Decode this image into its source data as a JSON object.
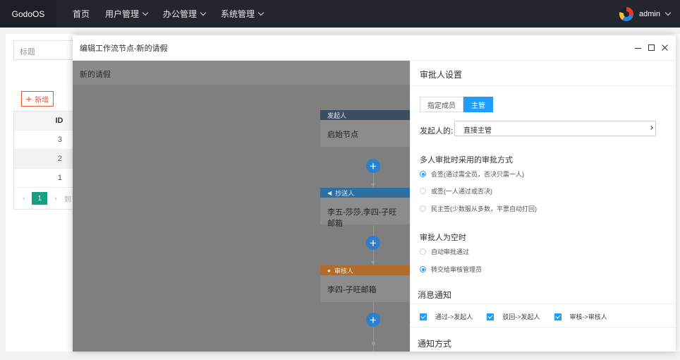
{
  "app": {
    "name": "GodoOS"
  },
  "nav": {
    "items": [
      {
        "label": "首页",
        "dropdown": false
      },
      {
        "label": "用户管理",
        "dropdown": true
      },
      {
        "label": "办公管理",
        "dropdown": true
      },
      {
        "label": "系统管理",
        "dropdown": true
      }
    ]
  },
  "user": {
    "name": "admin",
    "avatar_icon": "avatar-icon"
  },
  "background": {
    "search_placeholder": "标题",
    "add_label": "新增",
    "table": {
      "header": "ID",
      "rows": [
        "3",
        "2",
        "1"
      ]
    },
    "pager": {
      "prev": "‹",
      "current": "1",
      "next": "›",
      "goto": "到"
    }
  },
  "modal": {
    "title": "编辑工作流节点-新的请假",
    "canvas_title": "新的请假",
    "nodes": [
      {
        "type": "发起人",
        "content": "启始节点",
        "icon": ""
      },
      {
        "type": "抄送人",
        "content": "李五-莎莎,李四-子旺邮箱",
        "icon": "send-icon"
      },
      {
        "type": "审核人",
        "content": "李四-子旺邮箱",
        "icon": "user-icon"
      }
    ],
    "add_symbol": "+"
  },
  "panel": {
    "title": "审批人设置",
    "tabs": [
      {
        "label": "指定成员",
        "active": false
      },
      {
        "label": "主管",
        "active": true
      }
    ],
    "initiator_label": "发起人的:",
    "initiator_value": "直接主管",
    "multi_title": "多人审批时采用的审批方式",
    "multi_options": [
      {
        "label": "会签(通过需全员，否决只需一人)",
        "checked": true
      },
      {
        "label": "或签(一人通过或否决)",
        "checked": false
      },
      {
        "label": "民主签(少数服从多数，平票自动打回)",
        "checked": false
      }
    ],
    "empty_title": "审批人为空时",
    "empty_options": [
      {
        "label": "自动审批通过",
        "checked": false
      },
      {
        "label": "转交给审核管理员",
        "checked": true
      }
    ],
    "notify_title": "消息通知",
    "notify_options": [
      {
        "label": "通过->发起人",
        "checked": true
      },
      {
        "label": "驳回->发起人",
        "checked": true
      },
      {
        "label": "审核->审核人",
        "checked": true
      }
    ],
    "notify_method_title": "通知方式"
  },
  "colors": {
    "topbar": "#23262e",
    "accent_blue": "#1e9fff",
    "add_orange": "#e8572b",
    "page_green": "#16a085",
    "node_add_blue": "#2b7fcf"
  }
}
